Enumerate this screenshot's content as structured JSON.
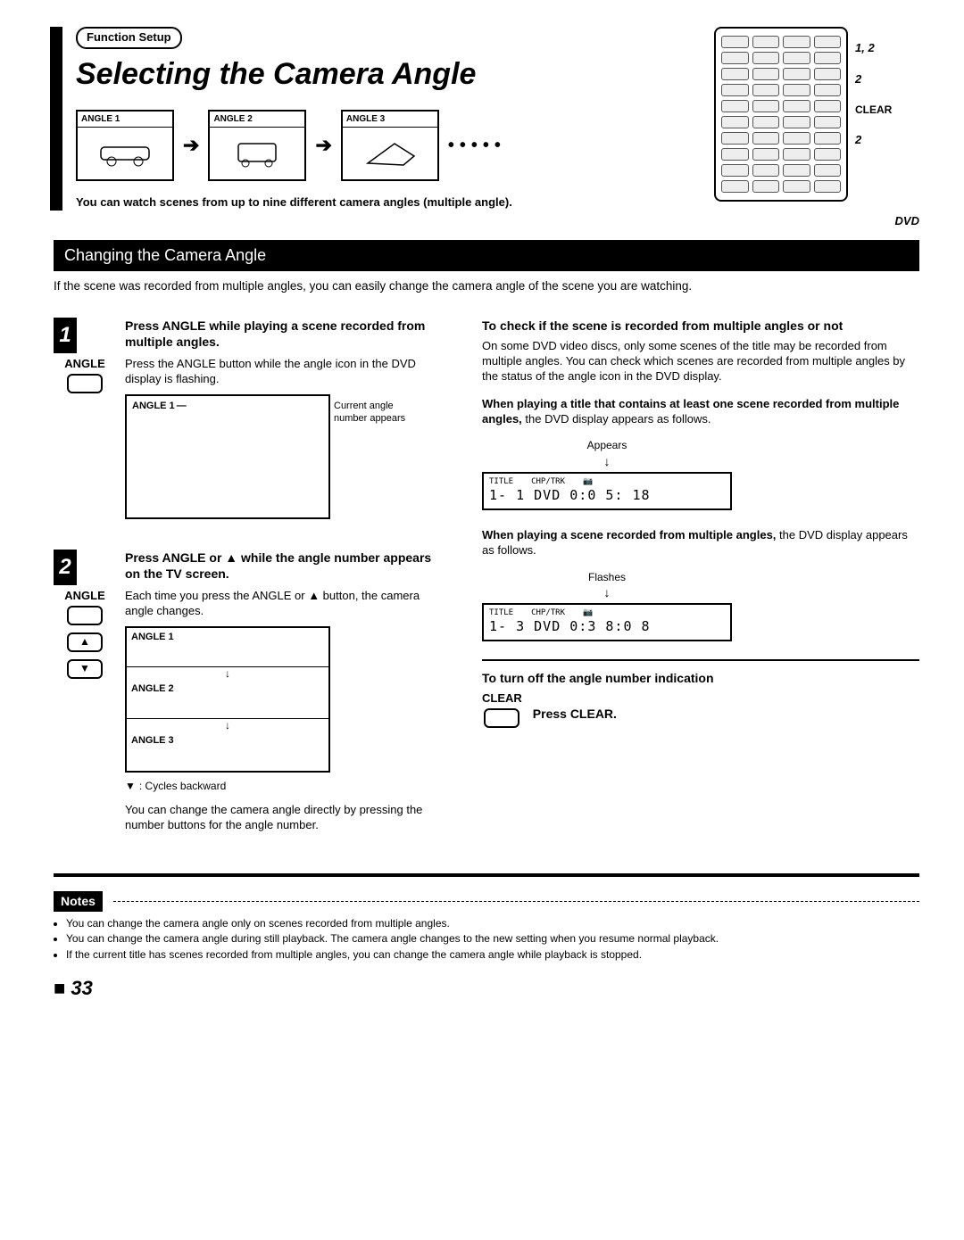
{
  "header": {
    "function_tag": "Function Setup",
    "title": "Selecting the Camera Angle",
    "angle_labels": [
      "ANGLE 1",
      "ANGLE 2",
      "ANGLE 3"
    ],
    "intro": "You can watch scenes from up to nine different camera angles (multiple angle).",
    "remote_labels": {
      "r1": "1, 2",
      "r2": "2",
      "clear": "CLEAR",
      "r3": "2"
    },
    "dvd_logo": "DVD"
  },
  "section_bar": "Changing the Camera Angle",
  "sub_intro": "If the scene was recorded from multiple angles, you can easily change the camera angle of the scene you are watching.",
  "step1": {
    "num": "1",
    "key_label": "ANGLE",
    "title": "Press ANGLE while playing a scene recorded from multiple angles.",
    "text": "Press the ANGLE button while the angle icon in the DVD display is flashing.",
    "osd_label": "ANGLE 1",
    "osd_note": "Current angle number appears"
  },
  "step2": {
    "num": "2",
    "key_label": "ANGLE",
    "title": "Press ANGLE or ▲ while the angle number appears on the TV screen.",
    "text": "Each time you press the ANGLE or ▲ button, the camera angle changes.",
    "stack": [
      "ANGLE 1",
      "ANGLE 2",
      "ANGLE 3"
    ],
    "cycles": ": Cycles backward",
    "para": "You can change the camera angle directly by pressing the number buttons for the angle number."
  },
  "right": {
    "h1": "To check if the scene is recorded from multiple angles or not",
    "p1": "On some DVD video discs, only some scenes of the title may be recorded from multiple angles. You can check which scenes are recorded from multiple angles by the status of the angle icon in the DVD display.",
    "h2a": "When playing a title that contains at least one scene recorded from multiple angles,",
    "h2b": " the DVD display appears as follows.",
    "cap1": "Appears",
    "disp1_row1a": "TITLE",
    "disp1_row1b": "CHP/TRK",
    "disp1_row2": "1-   1 DVD 0:0 5: 18",
    "h3a": "When playing a scene recorded from multiple angles,",
    "h3b": " the DVD display appears as follows.",
    "cap2": "Flashes",
    "disp2_row2": "1-   3 DVD 0:3 8:0 8",
    "h4": "To turn off the angle number indication",
    "clear_label": "CLEAR",
    "clear_text": "Press CLEAR."
  },
  "notes": {
    "tag": "Notes",
    "items": [
      "You can change the camera angle only on scenes recorded from multiple angles.",
      "You can change the camera angle during still playback. The camera angle changes to the new setting when you resume normal playback.",
      "If the current title has scenes recorded from multiple angles, you can change the camera angle while playback is stopped."
    ]
  },
  "page": "33"
}
